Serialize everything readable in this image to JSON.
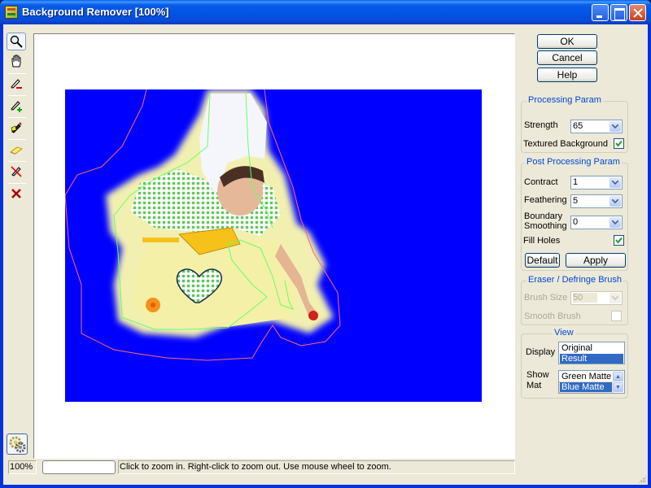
{
  "window": {
    "title": "Background Remover [100%]",
    "controls": [
      "minimize",
      "maximize",
      "close"
    ]
  },
  "toolbar": {
    "tools": [
      {
        "name": "zoom-tool",
        "icon": "magnifier-icon",
        "active": true
      },
      {
        "name": "pan-tool",
        "icon": "hand-icon",
        "active": false
      },
      {
        "name": "marker-remove-tool",
        "icon": "marker-minus-icon",
        "active": false
      },
      {
        "name": "marker-keep-tool",
        "icon": "marker-plus-icon",
        "active": false
      },
      {
        "name": "auto-marker-tool",
        "icon": "magic-marker-icon",
        "active": false
      },
      {
        "name": "eraser-tool",
        "icon": "eraser-icon",
        "active": false
      },
      {
        "name": "clear-marker-tool",
        "icon": "marker-crossed-icon",
        "active": false
      },
      {
        "name": "clear-all-tool",
        "icon": "red-x-icon",
        "active": false
      }
    ],
    "settings_icon": "gear-icon"
  },
  "dialog_buttons": {
    "ok": "OK",
    "cancel": "Cancel",
    "help": "Help"
  },
  "processing": {
    "title": "Processing Param",
    "strength_label": "Strength",
    "strength_value": "65",
    "textured_label": "Textured Background",
    "textured_checked": true
  },
  "post_processing": {
    "title": "Post Processing Param",
    "contract_label": "Contract",
    "contract_value": "1",
    "feathering_label": "Feathering",
    "feathering_value": "5",
    "boundary_label_1": "Boundary",
    "boundary_label_2": "Smoothing",
    "boundary_value": "0",
    "fill_holes_label": "Fill Holes",
    "fill_holes_checked": true,
    "default_button": "Default",
    "apply_button": "Apply"
  },
  "brush": {
    "title": "Eraser / Defringe  Brush",
    "size_label": "Brush Size",
    "size_value": "50",
    "smooth_label": "Smooth Brush",
    "smooth_checked": false,
    "enabled": false
  },
  "view": {
    "title": "View",
    "display_label": "Display",
    "display_options": [
      "Original",
      "Result"
    ],
    "display_selected": "Result",
    "mat_label_1": "Show",
    "mat_label_2": "Mat",
    "mat_options": [
      "Green Matte",
      "Blue Matte"
    ],
    "mat_selected": "Blue Matte"
  },
  "canvas": {
    "matte_color": "#0000ff",
    "keep_stroke_color": "#66ff66",
    "remove_stroke_color": "#ff6666"
  },
  "status": {
    "zoom": "100%",
    "progress": "",
    "message": "Click to zoom in. Right-click to zoom out. Use mouse wheel to zoom."
  }
}
